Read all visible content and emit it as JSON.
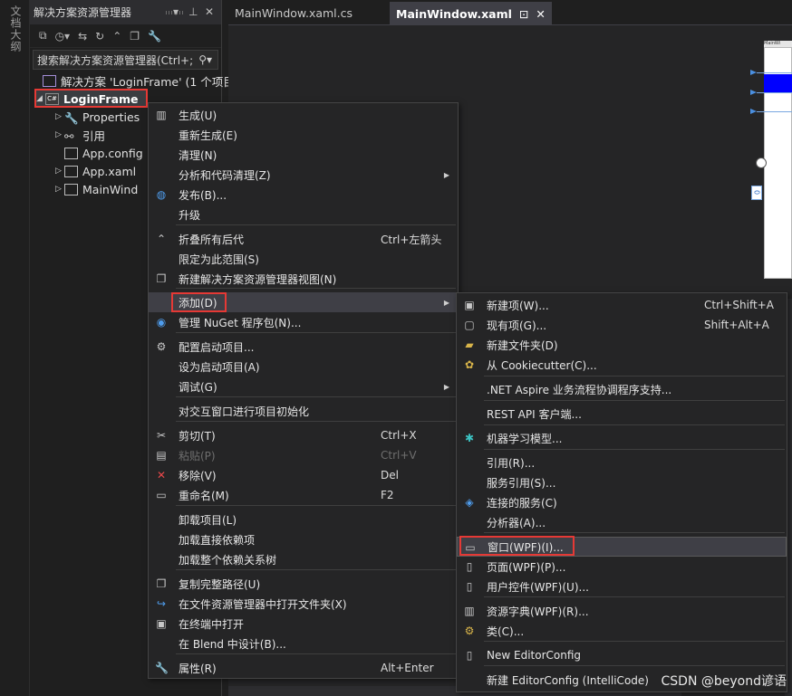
{
  "side_strip": {
    "label": "文档大纲"
  },
  "solution_explorer": {
    "title": "解决方案资源管理器",
    "search_placeholder": "搜索解决方案资源管理器(Ctrl+;",
    "solution_label": "解决方案 'LoginFrame' (1 个项目",
    "tree": [
      {
        "label": "LoginFrame",
        "icon": "csharp-project-icon"
      },
      {
        "label": "Properties",
        "icon": "wrench-icon"
      },
      {
        "label": "引用",
        "icon": "references-icon"
      },
      {
        "label": "App.config",
        "icon": "config-file-icon"
      },
      {
        "label": "App.xaml",
        "icon": "xaml-file-icon"
      },
      {
        "label": "MainWind",
        "icon": "xaml-file-icon"
      }
    ]
  },
  "tabs": [
    {
      "label": "MainWindow.xaml.cs"
    },
    {
      "label": "MainWindow.xaml",
      "active": true
    }
  ],
  "designer": {
    "header_text": "MainWi",
    "side_label": "0"
  },
  "context_menu": {
    "items": [
      {
        "label": "生成(U)",
        "icon": "build-icon"
      },
      {
        "label": "重新生成(E)"
      },
      {
        "label": "清理(N)"
      },
      {
        "label": "分析和代码清理(Z)",
        "submenu": true
      },
      {
        "label": "发布(B)...",
        "icon": "globe-icon"
      },
      {
        "label": "升级"
      },
      {
        "label": "折叠所有后代",
        "shortcut": "Ctrl+左箭头",
        "icon": "collapse-icon"
      },
      {
        "label": "限定为此范围(S)"
      },
      {
        "label": "新建解决方案资源管理器视图(N)",
        "icon": "new-view-icon"
      },
      {
        "label": "添加(D)",
        "submenu": true
      },
      {
        "label": "管理 NuGet 程序包(N)...",
        "icon": "nuget-icon"
      },
      {
        "label": "配置启动项目...",
        "icon": "gear-icon"
      },
      {
        "label": "设为启动项目(A)"
      },
      {
        "label": "调试(G)",
        "submenu": true
      },
      {
        "label": "对交互窗口进行项目初始化"
      },
      {
        "label": "剪切(T)",
        "shortcut": "Ctrl+X",
        "icon": "scissors-icon"
      },
      {
        "label": "粘贴(P)",
        "shortcut": "Ctrl+V",
        "icon": "paste-icon",
        "disabled": true
      },
      {
        "label": "移除(V)",
        "shortcut": "Del",
        "icon": "remove-icon"
      },
      {
        "label": "重命名(M)",
        "shortcut": "F2",
        "icon": "rename-icon"
      },
      {
        "label": "卸载项目(L)"
      },
      {
        "label": "加载直接依赖项"
      },
      {
        "label": "加载整个依赖关系树"
      },
      {
        "label": "复制完整路径(U)",
        "icon": "copy-icon"
      },
      {
        "label": "在文件资源管理器中打开文件夹(X)",
        "icon": "open-folder-icon"
      },
      {
        "label": "在终端中打开",
        "icon": "terminal-icon"
      },
      {
        "label": "在 Blend 中设计(B)..."
      },
      {
        "label": "属性(R)",
        "shortcut": "Alt+Enter",
        "icon": "wrench-icon"
      }
    ]
  },
  "add_submenu": {
    "items": [
      {
        "label": "新建项(W)...",
        "shortcut": "Ctrl+Shift+A",
        "icon": "new-item-icon"
      },
      {
        "label": "现有项(G)...",
        "shortcut": "Shift+Alt+A",
        "icon": "existing-item-icon"
      },
      {
        "label": "新建文件夹(D)",
        "icon": "new-folder-icon"
      },
      {
        "label": "从 Cookiecutter(C)...",
        "icon": "cookiecutter-icon"
      },
      {
        "label": ".NET Aspire 业务流程协调程序支持..."
      },
      {
        "label": "REST API 客户端..."
      },
      {
        "label": "机器学习模型...",
        "icon": "ml-model-icon"
      },
      {
        "label": "引用(R)..."
      },
      {
        "label": "服务引用(S)..."
      },
      {
        "label": "连接的服务(C)",
        "icon": "connected-service-icon"
      },
      {
        "label": "分析器(A)..."
      },
      {
        "label": "窗口(WPF)(I)...",
        "icon": "wpf-window-icon",
        "highlighted": true
      },
      {
        "label": "页面(WPF)(P)...",
        "icon": "wpf-page-icon"
      },
      {
        "label": "用户控件(WPF)(U)...",
        "icon": "wpf-usercontrol-icon"
      },
      {
        "label": "资源字典(WPF)(R)...",
        "icon": "resource-dictionary-icon"
      },
      {
        "label": "类(C)...",
        "icon": "class-icon"
      },
      {
        "label": "New EditorConfig",
        "icon": "editorconfig-icon"
      },
      {
        "label": "新建 EditorConfig (IntelliCode)"
      }
    ]
  },
  "watermark": "CSDN @beyond谚语"
}
